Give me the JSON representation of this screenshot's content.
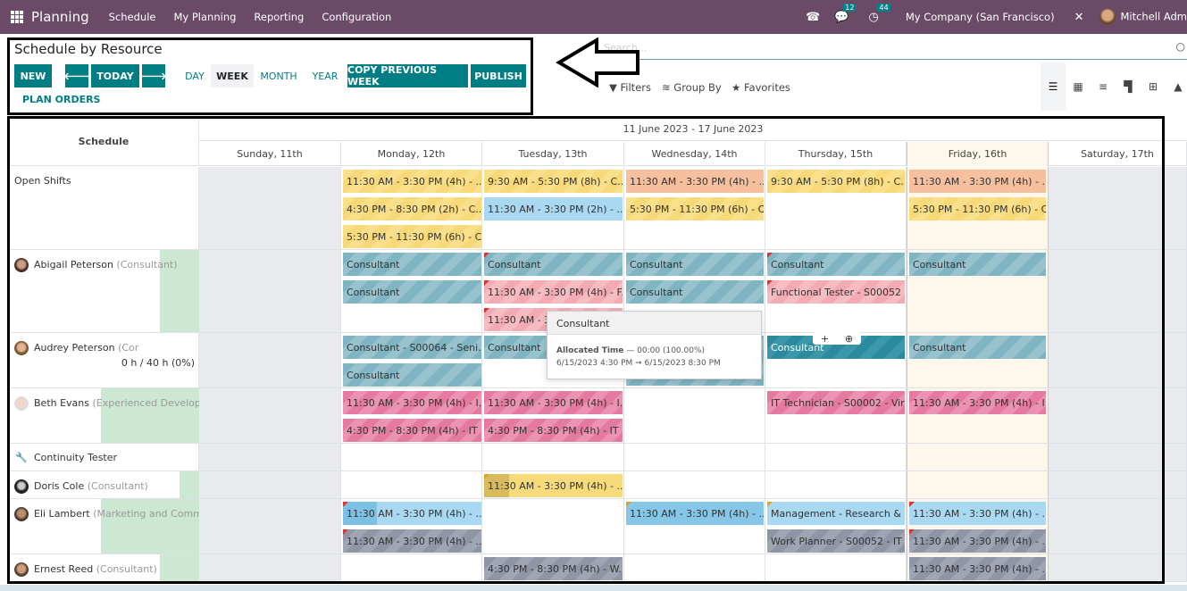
{
  "navbar": {
    "app_name": "Planning",
    "menus": [
      "Schedule",
      "My Planning",
      "Reporting",
      "Configuration"
    ],
    "icons": {
      "phone": "phone-icon",
      "chat": "chat-icon",
      "activity": "clock-icon",
      "debug": "tools-icon"
    },
    "chat_count": "12",
    "activity_count": "44",
    "company": "My Company (San Francisco)",
    "user": "Mitchell Adm"
  },
  "control": {
    "title": "Schedule by Resource",
    "new_label": "NEW",
    "prev_icon": "arrow-left-icon",
    "today_label": "TODAY",
    "next_icon": "arrow-right-icon",
    "scales": [
      "DAY",
      "WEEK",
      "MONTH",
      "YEAR"
    ],
    "active_scale": "WEEK",
    "copy_label": "COPY PREVIOUS WEEK",
    "publish_label": "PUBLISH",
    "plan_orders_label": "PLAN ORDERS",
    "search_placeholder": "Search...",
    "filters_label": "Filters",
    "groupby_label": "Group By",
    "favorites_label": "Favorites",
    "views": [
      "gantt",
      "calendar",
      "list",
      "kanban",
      "pivot",
      "graph"
    ],
    "active_view": "gantt"
  },
  "gantt": {
    "header_label": "Schedule",
    "range_label": "11 June 2023 - 17 June 2023",
    "days": [
      "Sunday, 11th",
      "Monday, 12th",
      "Tuesday, 13th",
      "Wednesday, 14th",
      "Thursday, 15th",
      "Friday, 16th",
      "Saturday, 17th"
    ],
    "today_index": 5,
    "rows": [
      {
        "name": "Open Shifts",
        "role": ""
      },
      {
        "name": "Abigail Peterson",
        "role": "(Consultant)"
      },
      {
        "name": "Audrey Peterson",
        "role": "(Cor",
        "hours": "0 h / 40 h (0%)"
      },
      {
        "name": "Beth Evans",
        "role": "(Experienced Developer)"
      },
      {
        "name": "Continuity Tester",
        "role": ""
      },
      {
        "name": "Doris Cole",
        "role": "(Consultant)"
      },
      {
        "name": "Eli Lambert",
        "role": "(Marketing and Commun"
      },
      {
        "name": "Ernest Reed",
        "role": "(Consultant)"
      }
    ],
    "pills": {
      "open_mon_1": "11:30 AM - 3:30 PM (4h) - ...",
      "open_mon_2": "4:30 PM - 8:30 PM (2h) - C...",
      "open_mon_3": "5:30 PM - 11:30 PM (6h) - C...",
      "open_tue_1": "9:30 AM - 5:30 PM (8h) - C...",
      "open_tue_2": "11:30 AM - 3:30 PM (2h) - ...",
      "open_wed_1": "11:30 AM - 3:30 PM (4h) - ...",
      "open_wed_2": "5:30 PM - 11:30 PM (6h) - C...",
      "open_thu_1": "9:30 AM - 5:30 PM (8h) - C...",
      "open_fri_1": "11:30 AM - 3:30 PM (4h) - ...",
      "open_fri_2": "5:30 PM - 11:30 PM (6h) - C...",
      "abi_mon_1": "Consultant",
      "abi_mon_2": "Consultant",
      "abi_tue_1": "Consultant",
      "abi_tue_2": "11:30 AM - 3:30 PM (4h) - F...",
      "abi_tue_3": "11:30 AM - 3",
      "abi_wed_1": "Consultant",
      "abi_wed_2": "Consultant",
      "abi_thu_1": "Consultant",
      "abi_thu_2": "Functional Tester - S00052 ...",
      "abi_fri_1": "Consultant",
      "aud_mon_1": "Consultant - S00064 - Seni...",
      "aud_mon_2": "Consultant",
      "aud_tue_1": "Consultant",
      "aud_thu_1": "Consultant",
      "aud_fri_1": "Consultant",
      "beth_mon_1": "11:30 AM - 3:30 PM (4h) - I...",
      "beth_mon_2": "4:30 PM - 8:30 PM (4h) - IT ...",
      "beth_tue_1": "11:30 AM - 3:30 PM (4h) - I...",
      "beth_tue_2": "4:30 PM - 8:30 PM (4h) - IT ...",
      "beth_thu_1": "IT Technician - S00002 - Vir...",
      "beth_fri_1": "11:30 AM - 3:30 PM (4h) - I...",
      "doris_tue_1": "11:30 AM - 3:30 PM (4h) - ...",
      "eli_mon_1": "11:30 AM - 3:30 PM (4h) - ...",
      "eli_mon_2": "11:30 AM - 3:30 PM (4h) - ...",
      "eli_wed_1": "11:30 AM - 3:30 PM (4h) - ...",
      "eli_thu_1": "Management - Research & ...",
      "eli_thu_2": "Work Planner - S00052 - IT ...",
      "eli_fri_1": "11:30 AM - 3:30 PM (4h) - ...",
      "eli_fri_2": "11:30 AM - 3:30 PM (4h) - ...",
      "ern_tue_1": "4:30 PM - 8:30 PM (4h) - W...",
      "ern_fri_1": "11:30 AM - 3:30 PM (4h) - ..."
    },
    "popover": {
      "title": "Consultant",
      "allocated_label": "Allocated Time",
      "allocated_value": "— 00:00 (100.00%)",
      "dates": "6/15/2023 4:30 PM ➞ 6/15/2023 8:30 PM"
    }
  },
  "colors": {
    "navbar": "#6b4a68",
    "primary": "#017e84"
  }
}
